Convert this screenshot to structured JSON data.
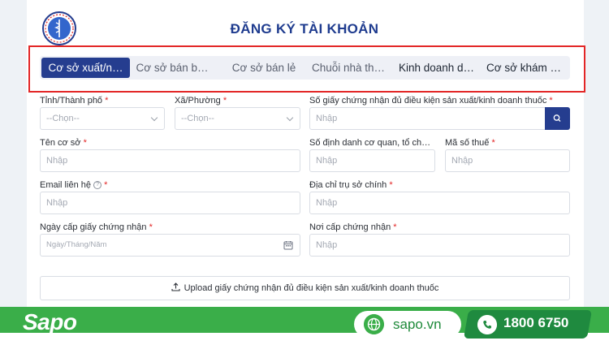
{
  "header": {
    "title": "ĐĂNG KÝ TÀI KHOẢN",
    "logo": "ministry-of-health-logo"
  },
  "tabs": [
    {
      "label": "Cơ sở xuất/n…",
      "active": true
    },
    {
      "label": "Cơ sở bán b…",
      "active": false
    },
    {
      "label": "Cơ sở bán lẻ",
      "active": false
    },
    {
      "label": "Chuỗi nhà th…",
      "active": false
    },
    {
      "label": "Kinh doanh d…",
      "active": false
    },
    {
      "label": "Cơ sở khám …",
      "active": false
    }
  ],
  "form": {
    "province": {
      "label": "Tỉnh/Thành phố",
      "placeholder": "--Chọn--"
    },
    "ward": {
      "label": "Xã/Phường",
      "placeholder": "--Chọn--"
    },
    "certificate_no": {
      "label": "Số giấy chứng nhận đủ điều kiện sản xuất/kinh doanh thuốc",
      "placeholder": "Nhập"
    },
    "facility_name": {
      "label": "Tên cơ sở",
      "placeholder": "Nhập"
    },
    "agency_id": {
      "label": "Số định danh cơ quan, tổ ch…",
      "placeholder": "Nhập"
    },
    "tax_code": {
      "label": "Mã số thuế",
      "placeholder": "Nhập"
    },
    "email": {
      "label": "Email liên hệ",
      "placeholder": "Nhập"
    },
    "address": {
      "label": "Địa chỉ trụ sở chính",
      "placeholder": "Nhập"
    },
    "issue_date": {
      "label": "Ngày cấp giấy chứng nhận",
      "placeholder": "Ngày/Tháng/Năm"
    },
    "issue_place": {
      "label": "Nơi cấp chứng nhận",
      "placeholder": "Nhập"
    },
    "required_mark": "*",
    "help_mark": "?",
    "upload_label": "Upload giấy chứng nhận đủ điều kiện sản xuất/kinh doanh thuốc"
  },
  "footer": {
    "brand": "Sapo",
    "website": "sapo.vn",
    "phone": "1800 6750"
  },
  "colors": {
    "primary": "#253d8f",
    "highlight": "#e32626",
    "brand": "#3aae49"
  }
}
